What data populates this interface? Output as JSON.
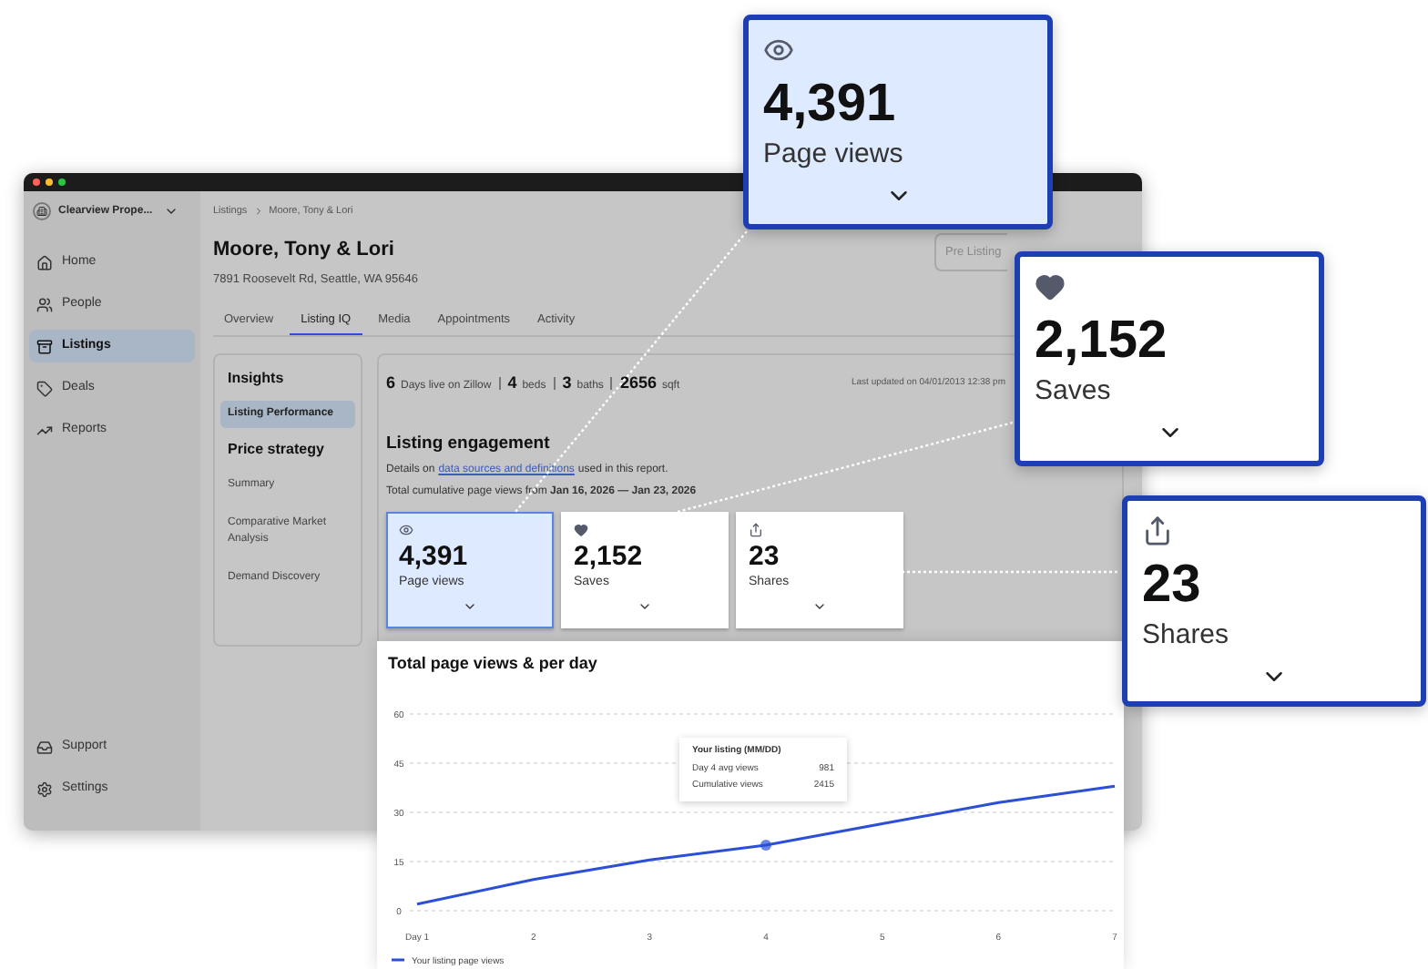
{
  "sidebar": {
    "account": "Clearview Prope...",
    "items": [
      {
        "label": "Home",
        "selected": false
      },
      {
        "label": "People",
        "selected": false
      },
      {
        "label": "Listings",
        "selected": true
      },
      {
        "label": "Deals",
        "selected": false
      },
      {
        "label": "Reports",
        "selected": false
      }
    ],
    "footer_items": [
      "Support",
      "Settings"
    ]
  },
  "breadcrumb": [
    "Listings",
    "Moore, Tony & Lori"
  ],
  "listing": {
    "name": "Moore, Tony & Lori",
    "address": "7891 Roosevelt Rd, Seattle, WA 95646"
  },
  "action_button": "Pre Listing",
  "tabs": [
    {
      "label": "Overview",
      "selected": false
    },
    {
      "label": "Listing IQ",
      "selected": true
    },
    {
      "label": "Media",
      "selected": false
    },
    {
      "label": "Appointments",
      "selected": false
    },
    {
      "label": "Activity",
      "selected": false
    }
  ],
  "insights_nav": [
    {
      "title": "Insights",
      "items": [
        {
          "label": "Listing Performance",
          "selected": true
        }
      ]
    },
    {
      "title": "Price strategy",
      "items": [
        {
          "label": "Summary",
          "selected": false
        },
        {
          "label": "Comparative Market Analysis",
          "selected": false
        },
        {
          "label": "Demand Discovery",
          "selected": false
        }
      ]
    }
  ],
  "stats": [
    {
      "value": "6",
      "unit": "Days live on Zillow"
    },
    {
      "value": "4",
      "unit": "beds"
    },
    {
      "value": "3",
      "unit": "baths"
    },
    {
      "value": "2656",
      "unit": "sqft"
    }
  ],
  "last_updated": "Last updated on 04/01/2013 12:38 pm",
  "engagement": {
    "title": "Listing engagement",
    "details_before": "Details on",
    "details_link": "data sources and definitions",
    "details_after": "used in this report.",
    "range": "Total cumulative page views from **Jan 16, 2026 — Jan 23, 2026**"
  },
  "metrics": [
    {
      "kind": "views",
      "value": "4,391",
      "label": "Page views",
      "selected": true
    },
    {
      "kind": "saves",
      "value": "2,152",
      "label": "Saves",
      "selected": false
    },
    {
      "kind": "shares",
      "value": "23",
      "label": "Shares",
      "selected": false
    }
  ],
  "chart": {
    "title": "Total page views & per day",
    "chart_data": {
      "type": "line",
      "categories": [
        "Day 1",
        "2",
        "3",
        "4",
        "5",
        "6",
        "7"
      ],
      "ylim": [
        0,
        60
      ],
      "grid": true,
      "yticks": [
        0,
        15,
        30,
        45,
        60
      ],
      "series": [
        {
          "name": "Your listing page views",
          "color": "#2b4fd8",
          "values": [
            2,
            9.5,
            15.5,
            20,
            26.5,
            33,
            38
          ]
        }
      ]
    },
    "tooltip": {
      "title": "Your listing (MM/DD)",
      "rows": [
        {
          "label": "Day 4 avg views",
          "value": "981"
        },
        {
          "label": "Cumulative views",
          "value": "2415"
        }
      ]
    }
  },
  "callouts": [
    {
      "kind": "views",
      "value": "4,391",
      "label": "Page views"
    },
    {
      "kind": "saves",
      "value": "2,152",
      "label": "Saves"
    },
    {
      "kind": "shares",
      "value": "23",
      "label": "Shares"
    }
  ]
}
